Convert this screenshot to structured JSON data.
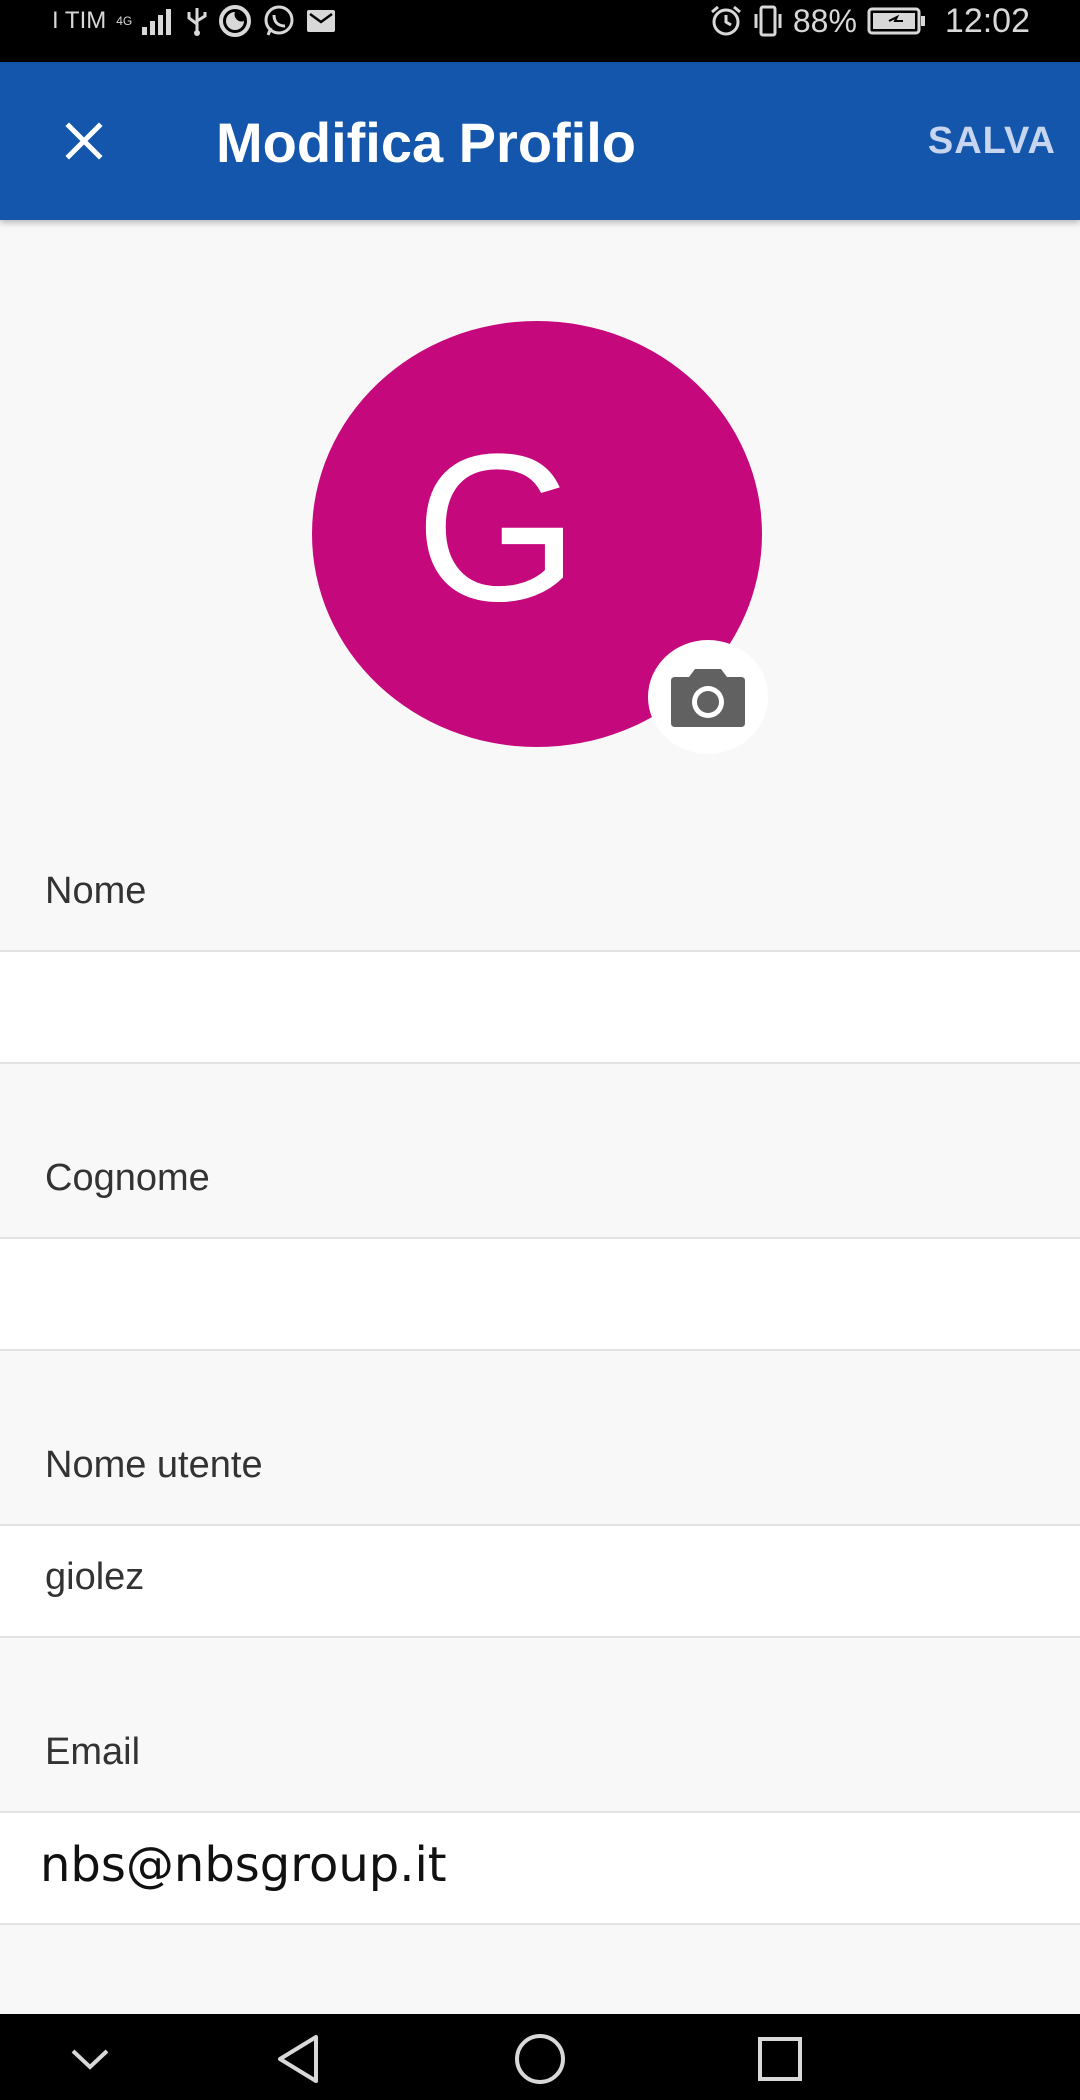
{
  "status_bar": {
    "carrier": "I TIM",
    "network_top": "4G",
    "network_bottom": "4G",
    "battery_percent": "88%",
    "time": "12:02",
    "icons": [
      "signal-icon",
      "usb-icon",
      "moon-icon",
      "whatsapp-icon",
      "mail-icon",
      "alarm-icon",
      "vibrate-icon",
      "battery-icon"
    ]
  },
  "app_bar": {
    "title": "Modifica Profilo",
    "save_label": "SALVA",
    "close_icon": "close-icon",
    "color": "#1356ab"
  },
  "avatar": {
    "initial": "G",
    "color": "#c5087c",
    "camera_icon": "camera-icon"
  },
  "form": {
    "first_name": {
      "label": "Nome",
      "value": ""
    },
    "last_name": {
      "label": "Cognome",
      "value": ""
    },
    "username": {
      "label": "Nome utente",
      "value": "giolez"
    },
    "email": {
      "label": "Email",
      "value": "nbs@nbsgroup.it"
    }
  },
  "nav_bar": {
    "icons": [
      "chevron-down-icon",
      "back-icon",
      "home-icon",
      "recents-icon"
    ]
  }
}
